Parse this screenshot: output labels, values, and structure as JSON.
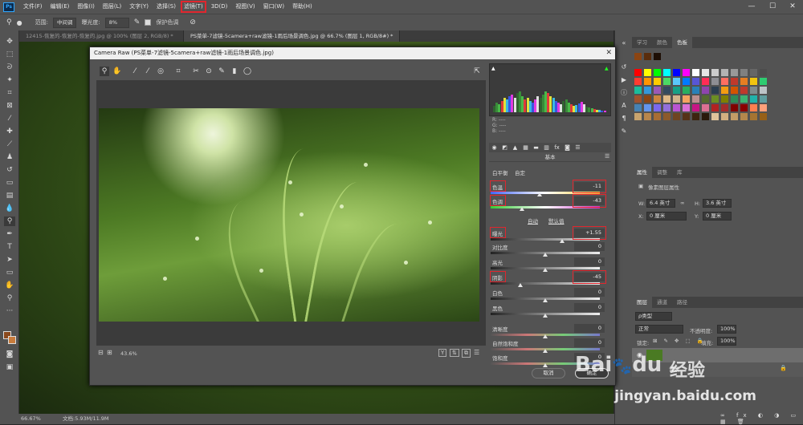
{
  "menubar": {
    "items": [
      "文件(F)",
      "编辑(E)",
      "图像(I)",
      "图层(L)",
      "文字(Y)",
      "选择(S)",
      "滤镜(T)",
      "3D(D)",
      "视图(V)",
      "窗口(W)",
      "帮助(H)"
    ],
    "highlighted_item": "滤镜(T)"
  },
  "window_controls": {
    "minimize": "—",
    "maximize": "☐",
    "close": "✕"
  },
  "options_bar": {
    "range_label": "范围:",
    "range_value": "中间调",
    "exposure_label": "曝光度:",
    "exposure_value": "8%",
    "protect_label": "保护色调"
  },
  "tabs": [
    {
      "label": "12415-恢复的-恢复的-恢复的.jpg @ 100% (图层 2, RGB/8) *",
      "active": false
    },
    {
      "label": "PS菜单-7滤镜-5camera+raw滤镜-1雨后场景调色.jpg @ 66.7% (图层 1, RGB/8#) *",
      "active": true
    }
  ],
  "status": {
    "zoom": "66.67%",
    "doc": "文档:5.93M/11.9M"
  },
  "camera_raw": {
    "title": "Camera Raw (PS菜单-7滤镜-5camera+raw滤镜-1雨后场景调色.jpg)",
    "rgb_labels": [
      "R: ----",
      "G: ----",
      "B: ----"
    ],
    "panel_title": "基本",
    "white_balance_label": "白平衡",
    "white_balance_value": "自定",
    "auto_label": "自动",
    "default_label": "默认值",
    "zoom_value": "43.6%",
    "sliders": [
      {
        "label": "色温",
        "value": "-11",
        "highlight": true
      },
      {
        "label": "色调",
        "value": "-43",
        "highlight": true
      },
      {
        "label": "曝光",
        "value": "+1.55",
        "highlight": true
      },
      {
        "label": "对比度",
        "value": "0",
        "highlight": false
      },
      {
        "label": "高光",
        "value": "0",
        "highlight": false
      },
      {
        "label": "阴影",
        "value": "-45",
        "highlight": true
      },
      {
        "label": "白色",
        "value": "0",
        "highlight": false
      },
      {
        "label": "黑色",
        "value": "0",
        "highlight": false
      },
      {
        "label": "清晰度",
        "value": "0",
        "highlight": false
      },
      {
        "label": "自然饱和度",
        "value": "0",
        "highlight": false
      },
      {
        "label": "饱和度",
        "value": "0",
        "highlight": false
      }
    ],
    "cancel_label": "取消",
    "ok_label": "确定"
  },
  "right_panel": {
    "color_tabs": [
      "学习",
      "颜色",
      "色板"
    ],
    "props_tabs": [
      "属性",
      "调整",
      "库"
    ],
    "props_title": "像素图层属性",
    "w_label": "W:",
    "w_value": "6.4 英寸",
    "h_label": "H:",
    "h_value": "3.6 英寸",
    "x_label": "X:",
    "x_value": "0 厘米",
    "y_label": "Y:",
    "y_value": "0 厘米",
    "layers_tabs": [
      "图层",
      "通道",
      "路径"
    ],
    "filter_label": "ρ类型",
    "blend_mode": "正常",
    "opacity_label": "不透明度:",
    "opacity_value": "100%",
    "lock_label": "锁定:",
    "fill_label": "填充:",
    "fill_value": "100%",
    "layer_name": "背景"
  },
  "watermark": {
    "brand": "Bai",
    "brand2": "du",
    "cn": "经验",
    "url": "jingyan.baidu.com"
  },
  "colors": {
    "highlight_red": "#e0262e",
    "ps_blue": "#31a8ff"
  }
}
